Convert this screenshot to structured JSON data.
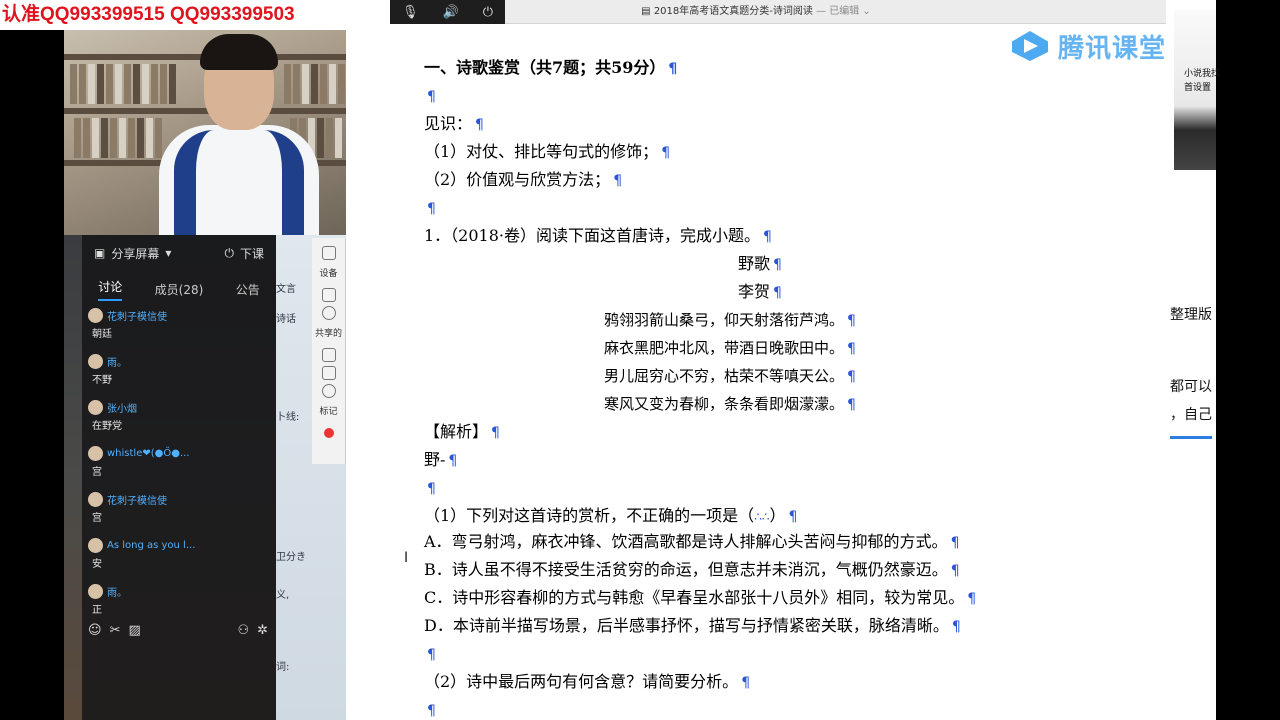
{
  "watermark": {
    "text": "认准QQ993399515  QQ993399503"
  },
  "tray": {
    "icons": [
      "mic-icon",
      "speaker-icon",
      "power-icon"
    ]
  },
  "window": {
    "title": "2018年高考语文真题分类-诗词阅读",
    "edit_state": "— 已编辑 ⌄"
  },
  "logo": {
    "name": "腾讯课堂"
  },
  "chat": {
    "share_label": "分享屏幕",
    "end_label": "下课",
    "tabs": [
      "讨论",
      "成员(28)",
      "公告"
    ],
    "messages": [
      {
        "user": "花刺子模信使",
        "text": "朝廷"
      },
      {
        "user": "雨。",
        "text": "不野"
      },
      {
        "user": "张小烟",
        "text": "在野党"
      },
      {
        "user": "whistle❤(●Ő●...",
        "text": "宫"
      },
      {
        "user": "花刺子模信使",
        "text": "宫"
      },
      {
        "user": "As long as you l...",
        "text": "安"
      },
      {
        "user": "雨。",
        "text": "正"
      }
    ]
  },
  "tools": {
    "device_label": "设备",
    "shared_label": "共享的",
    "mark_label": "标记"
  },
  "bg_left": {
    "t1": "文言",
    "t2": "诗话",
    "t3": "卜线:",
    "t4": "卫分き",
    "t5": "义,",
    "t6": "词:"
  },
  "bg_right": {
    "t1": "小说我找",
    "t2": "首设置",
    "t3": "整理版",
    "t4": "都可以",
    "t5": "，自己"
  },
  "doc": {
    "heading": "一、诗歌鉴赏（共7题；共59分）",
    "insight_label": "见识：",
    "insight_1": "（1）对仗、排比等句式的修饰；",
    "insight_2": "（2）价值观与欣赏方法；",
    "q1": "1．（2018·卷）阅读下面这首唐诗，完成小题。",
    "poem_title": "野歌",
    "poem_author": "李贺",
    "poem_lines": [
      "鸦翎羽箭山桑弓，仰天射落衔芦鸿。",
      "麻衣黑肥冲北风，带酒日晚歌田中。",
      "男儿屈穷心不穷，枯荣不等嗔天公。",
      "寒风又变为春柳，条条看即烟濛濛。"
    ],
    "analysis_label": "【解析】",
    "analysis_text": "野-",
    "sub1": "（1）下列对这首诗的赏析，不正确的一项是（",
    "sub1_blank": "∴∴",
    "sub1_end": "）",
    "options": [
      "A．弯弓射鸿，麻衣冲锋、饮酒高歌都是诗人排解心头苦闷与抑郁的方式。",
      "B．诗人虽不得不接受生活贫穷的命运，但意志并未消沉，气概仍然豪迈。",
      "C．诗中形容春柳的方式与韩愈《早春呈水部张十八员外》相同，较为常见。",
      "D．本诗前半描写场景，后半感事抒怀，描写与抒情紧密关联，脉络清晰。"
    ],
    "sub2": "（2）诗中最后两句有何含意？请简要分析。",
    "pilcrow": "¶"
  }
}
